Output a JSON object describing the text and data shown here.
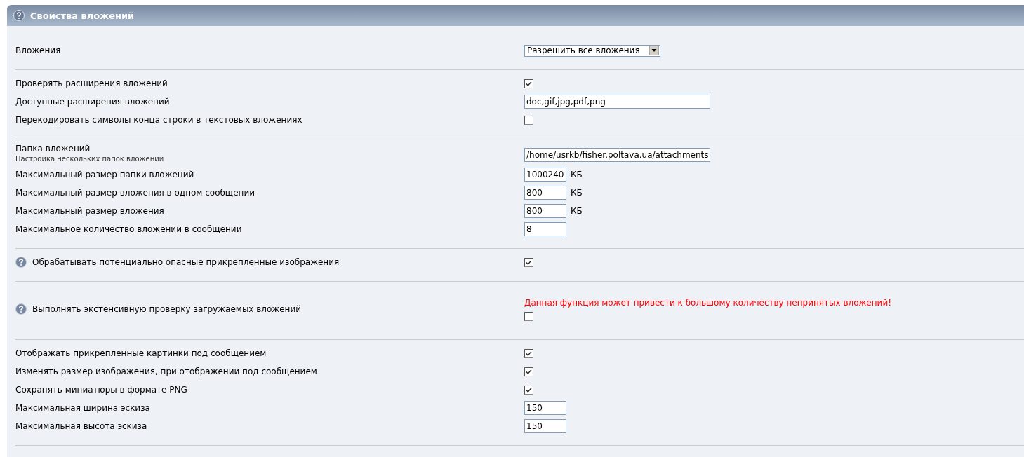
{
  "panel": {
    "title": "Свойства вложений",
    "help": true
  },
  "sections": [
    {
      "rows": [
        {
          "label": "Вложения",
          "kind": "select",
          "value": "Разрешить все вложения"
        }
      ]
    },
    {
      "rows": [
        {
          "label": "Проверять расширения вложений",
          "kind": "checkbox",
          "checked": true
        },
        {
          "label": "Доступные расширения вложений",
          "kind": "text",
          "value": "doc,gif,jpg,pdf,png"
        },
        {
          "label": "Перекодировать символы конца строки в текстовых вложениях",
          "kind": "checkbox",
          "checked": false
        }
      ]
    },
    {
      "rows": [
        {
          "label": "Папка вложений",
          "note": "Настройка нескольких папок вложений",
          "kind": "text",
          "value": "/home/usrkb/fisher.poltava.ua/attachments"
        },
        {
          "label": "Максимальный размер папки вложений",
          "kind": "number",
          "value": "1000240",
          "unit": "КБ"
        },
        {
          "label": "Максимальный размер вложения в одном сообщении",
          "kind": "number",
          "value": "800",
          "unit": "КБ"
        },
        {
          "label": "Максимальный размер вложения",
          "kind": "number",
          "value": "800",
          "unit": "КБ"
        },
        {
          "label": "Максимальное количество вложений в сообщении",
          "kind": "number",
          "value": "8"
        }
      ]
    },
    {
      "rows": [
        {
          "label": "Обрабатывать потенциально опасные прикрепленные изображения",
          "help": true,
          "kind": "checkbox",
          "checked": true
        }
      ]
    },
    {
      "rows": [
        {
          "label": "Выполнять экстенсивную проверку загружаемых вложений",
          "help": true,
          "warning": "Данная функция может привести к большому количеству непринятых вложений!",
          "kind": "checkbox",
          "checked": false
        }
      ]
    },
    {
      "rows": [
        {
          "label": "Отображать прикрепленные картинки под сообщением",
          "kind": "checkbox",
          "checked": true
        },
        {
          "label": "Изменять размер изображения, при отображении под сообщением",
          "kind": "checkbox",
          "checked": true
        },
        {
          "label": "Сохранять миниатюры в формате PNG",
          "kind": "checkbox",
          "checked": true
        },
        {
          "label": "Максимальная ширина эскиза",
          "kind": "number",
          "value": "150"
        },
        {
          "label": "Максимальная высота эскиза",
          "kind": "number",
          "value": "150"
        }
      ]
    }
  ]
}
